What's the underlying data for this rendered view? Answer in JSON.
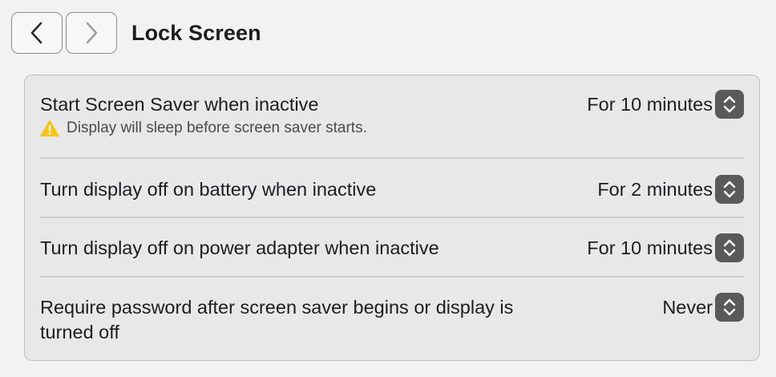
{
  "header": {
    "title": "Lock Screen",
    "back_icon": "chevron-left-icon",
    "forward_icon": "chevron-right-icon"
  },
  "settings": {
    "rows": [
      {
        "label": "Start Screen Saver when inactive",
        "value": "For 10 minutes",
        "warning": "Display will sleep before screen saver starts."
      },
      {
        "label": "Turn display off on battery when inactive",
        "value": "For 2 minutes"
      },
      {
        "label": "Turn display off on power adapter when inactive",
        "value": "For 10 minutes"
      },
      {
        "label_line1": "Require password after screen saver begins or display is",
        "label_line2": "turned off",
        "value": "Never"
      }
    ]
  },
  "icons": {
    "warning": "warning-triangle-icon",
    "stepper": "chevron-up-down-icon"
  },
  "colors": {
    "warning": "#f5c518",
    "stepper": "#5a5a5a"
  }
}
